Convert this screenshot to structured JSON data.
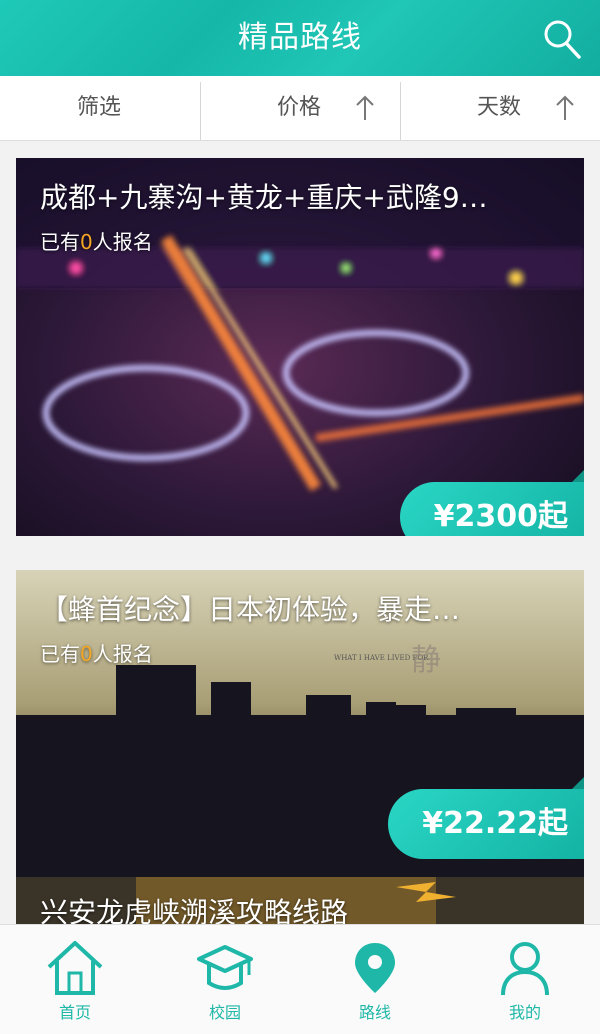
{
  "header": {
    "title": "精品路线"
  },
  "filters": [
    {
      "label": "筛选"
    },
    {
      "label": "价格"
    },
    {
      "label": "天数"
    }
  ],
  "routes": [
    {
      "title": "成都+九寨沟+黄龙+重庆+武隆9…",
      "sub_prefix": "已有",
      "count": "0",
      "sub_suffix": "人报名",
      "price": "¥2300起"
    },
    {
      "title": "【蜂首纪念】日本初体验，暴走…",
      "sub_prefix": "已有",
      "count": "0",
      "sub_suffix": "人报名",
      "price": "¥22.22起"
    },
    {
      "title": "兴安龙虎峡溯溪攻略线路"
    }
  ],
  "tabs": [
    {
      "label": "首页",
      "icon": "home-icon"
    },
    {
      "label": "校园",
      "icon": "graduation-cap-icon"
    },
    {
      "label": "路线",
      "icon": "location-pin-icon",
      "active": true
    },
    {
      "label": "我的",
      "icon": "user-icon"
    }
  ],
  "colors": {
    "accent": "#1fc2b2",
    "count_highlight": "#f5a623"
  }
}
